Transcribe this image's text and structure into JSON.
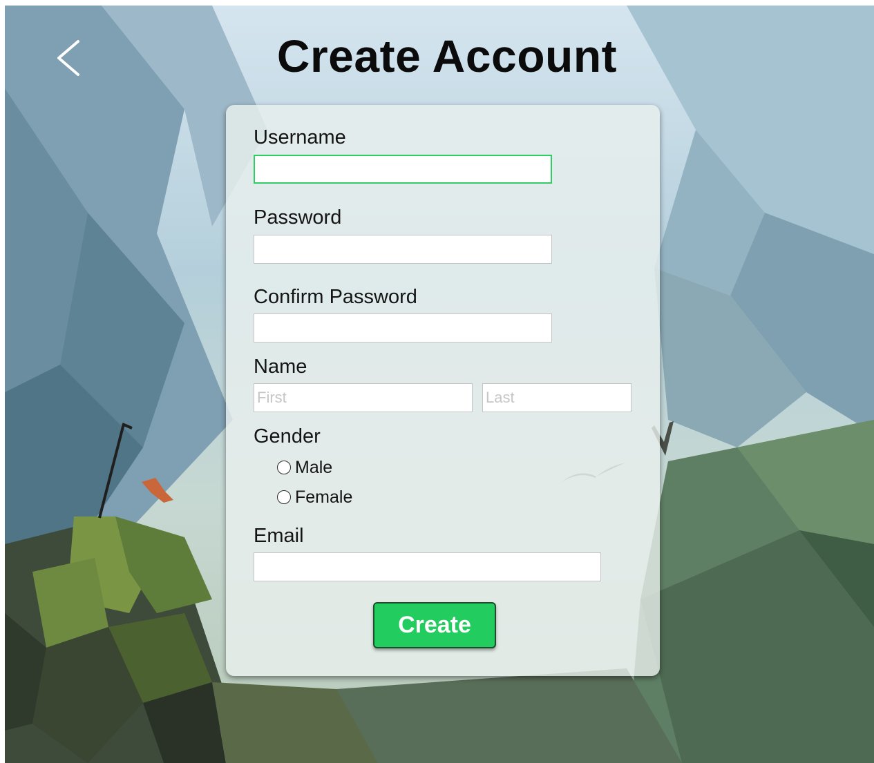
{
  "header": {
    "back_icon": "chevron-left-icon",
    "title": "Create Account"
  },
  "form": {
    "username": {
      "label": "Username",
      "value": ""
    },
    "password": {
      "label": "Password",
      "value": ""
    },
    "confirm_password": {
      "label": "Confirm Password",
      "value": ""
    },
    "name": {
      "label": "Name",
      "first_placeholder": "First",
      "last_placeholder": "Last"
    },
    "gender": {
      "label": "Gender",
      "options": [
        "Male",
        "Female"
      ],
      "selected": null
    },
    "email": {
      "label": "Email",
      "value": ""
    },
    "submit_label": "Create"
  },
  "colors": {
    "accent": "#22cc5e",
    "focus_border": "#2fcd62",
    "title": "#0b0b0b"
  }
}
